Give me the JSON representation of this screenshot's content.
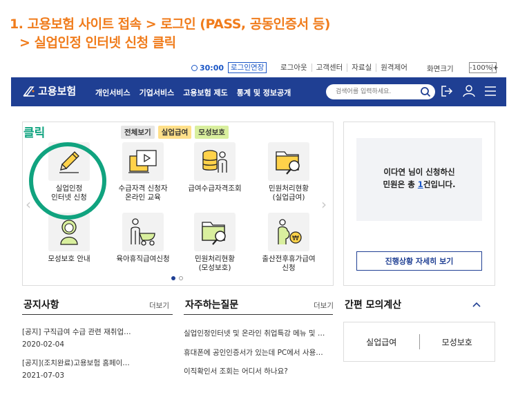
{
  "instruction": {
    "line1": "1. 고용보험 사이트 접속 > 로그인 (PASS, 공동인증서 등)",
    "line2": "> 실업인정 인터넷 신청 클릭"
  },
  "util": {
    "timer": "30:00",
    "extend": "로그인연장",
    "links": [
      "로그아웃",
      "고객센터",
      "자료실",
      "원격제어"
    ],
    "zoom_label": "화면크기",
    "zoom_minus": "-",
    "zoom_value": "100%",
    "zoom_plus": "+"
  },
  "nav": {
    "logo": "고용보험",
    "menu": [
      "개인서비스",
      "기업서비스",
      "고용보험 제도",
      "통계 및 정보공개"
    ],
    "search_placeholder": "검색어를 입력하세요."
  },
  "annotation": {
    "click_label": "클릭"
  },
  "tags": [
    "전체보기",
    "실업급여",
    "모성보호"
  ],
  "services": [
    {
      "line1": "실업인정",
      "line2": "인터넷 신청"
    },
    {
      "line1": "수급자격 신청자",
      "line2": "온라인 교육"
    },
    {
      "line1": "급여수급자격조회",
      "line2": ""
    },
    {
      "line1": "민원처리현황",
      "line2": "(실업급여)"
    },
    {
      "line1": "모성보호 안내",
      "line2": ""
    },
    {
      "line1": "육아휴직급여신청",
      "line2": ""
    },
    {
      "line1": "민원처리현황",
      "line2": "(모성보호)"
    },
    {
      "line1": "출산전후휴가급여",
      "line2": "신청"
    }
  ],
  "greeting": {
    "line1": "이다연 님이 신청하신",
    "prefix": "민원은 총 ",
    "count": "1",
    "suffix": "건입니다."
  },
  "status_button": "진행상황 자세히 보기",
  "notices": {
    "title": "공지사항",
    "more": "더보기",
    "items": [
      {
        "text": "[공지] 구직급여 수급 관련 재취업…",
        "date": "2020-02-04"
      },
      {
        "text": "[공지](조치완료)고용보험 홈페이…",
        "date": "2021-07-03"
      }
    ]
  },
  "faq": {
    "title": "자주하는질문",
    "more": "더보기",
    "items": [
      "실업인정인터넷 및 온라인 취업특강 메뉴 및 …",
      "휴대폰에 공인인증서가 있는데 PC에서 사용…",
      "이직확인서 조회는 어디서 하나요?"
    ]
  },
  "mock_calc": {
    "title": "간편 모의계산",
    "buttons": [
      "실업급여",
      "모성보호"
    ]
  },
  "colors": {
    "brand_navy": "#1f3f93",
    "instruction_orange": "#f07c1c",
    "annotation_green": "#10a37f",
    "link_blue": "#1a56c6"
  }
}
